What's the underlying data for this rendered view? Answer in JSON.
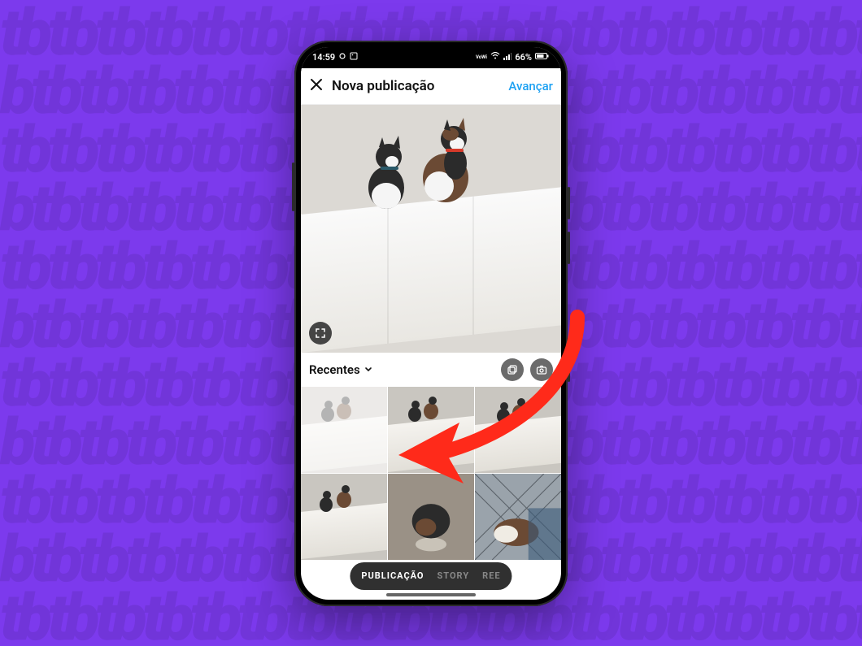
{
  "statusbar": {
    "time": "14:59",
    "battery_text": "66%",
    "icons_left": [
      "screenshot-icon",
      "picture-icon"
    ],
    "icons_right": [
      "vowifi-icon",
      "wifi-icon",
      "signal-icon",
      "battery-icon"
    ]
  },
  "header": {
    "close_icon": "close-icon",
    "title": "Nova publicação",
    "next_label": "Avançar"
  },
  "preview": {
    "expand_icon": "expand-icon",
    "image_desc": "two-cats-on-white-cabinet"
  },
  "gallery": {
    "source_label": "Recentes",
    "chevron_icon": "chevron-down-icon",
    "multi_icon": "stack-icon",
    "camera_icon": "camera-icon",
    "thumbs": [
      {
        "desc": "cats-on-cabinet-1",
        "selected": true
      },
      {
        "desc": "cats-on-cabinet-2",
        "selected": false
      },
      {
        "desc": "cats-on-cabinet-3",
        "selected": false
      },
      {
        "desc": "cats-on-cabinet-4",
        "selected": false
      },
      {
        "desc": "cat-eating-bowl",
        "selected": false
      },
      {
        "desc": "cat-on-balcony",
        "selected": false
      }
    ]
  },
  "tabs": {
    "items": [
      "PUBLICAÇÃO",
      "STORY",
      "REE"
    ],
    "active_index": 0
  },
  "annotation": {
    "arrow_color": "#ff2a1a"
  }
}
